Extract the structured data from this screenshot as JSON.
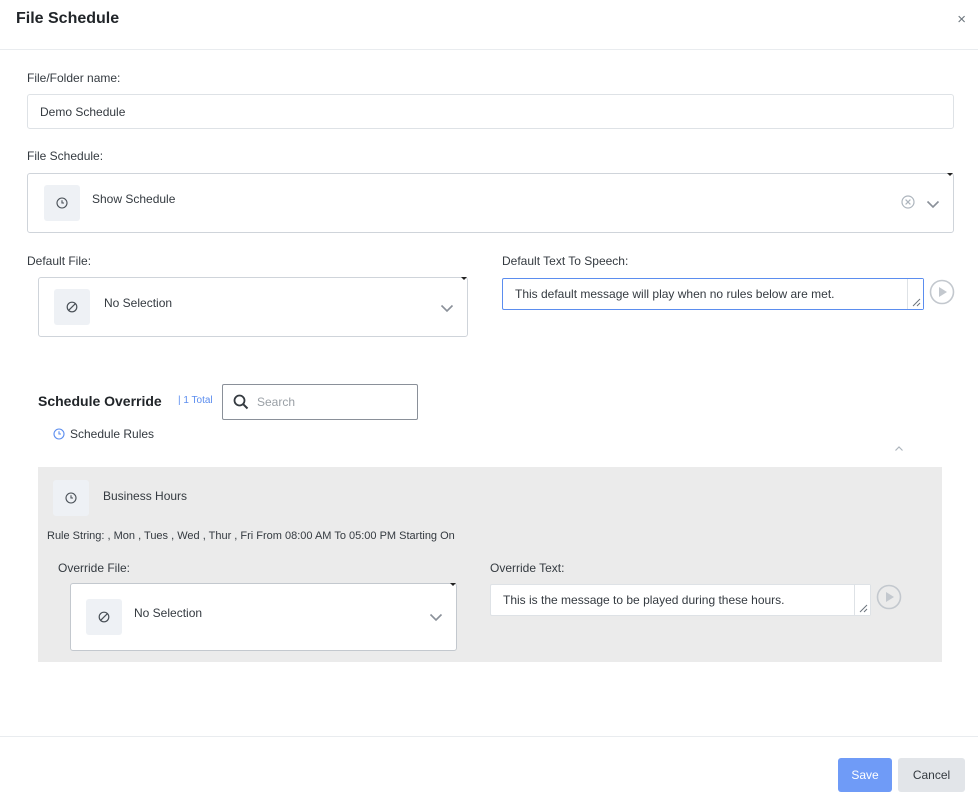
{
  "dialog": {
    "title": "File Schedule",
    "close_glyph": "×"
  },
  "form": {
    "name_label": "File/Folder name:",
    "name_value": "Demo Schedule",
    "schedule_label": "File Schedule:",
    "schedule_value": "Show Schedule",
    "default_file_label": "Default File:",
    "default_file_value": "No Selection",
    "default_tts_label": "Default Text To Speech:",
    "default_tts_value": "This default message will play when no rules below are met."
  },
  "override": {
    "title": "Schedule Override",
    "total": "| 1 Total",
    "search_placeholder": "Search",
    "rules_label": "Schedule Rules",
    "rule": {
      "name": "Business Hours",
      "rule_string": "Rule String: , Mon , Tues , Wed , Thur , Fri From 08:00 AM To 05:00 PM Starting On",
      "override_file_label": "Override File:",
      "override_file_value": "No Selection",
      "override_text_label": "Override Text:",
      "override_text_value": "This is the message to be played during these hours."
    }
  },
  "footer": {
    "save_label": "Save",
    "cancel_label": "Cancel"
  },
  "colors": {
    "accent": "#6f9bf7",
    "panel_bg": "#ebebeb",
    "link_blue": "#5b8def"
  },
  "icons": {
    "clock": "clock-icon",
    "no_selection": "ban-icon",
    "chevron": "chevron-down-icon",
    "clear": "clear-circle-icon",
    "play": "play-circle-icon",
    "search": "search-icon"
  }
}
